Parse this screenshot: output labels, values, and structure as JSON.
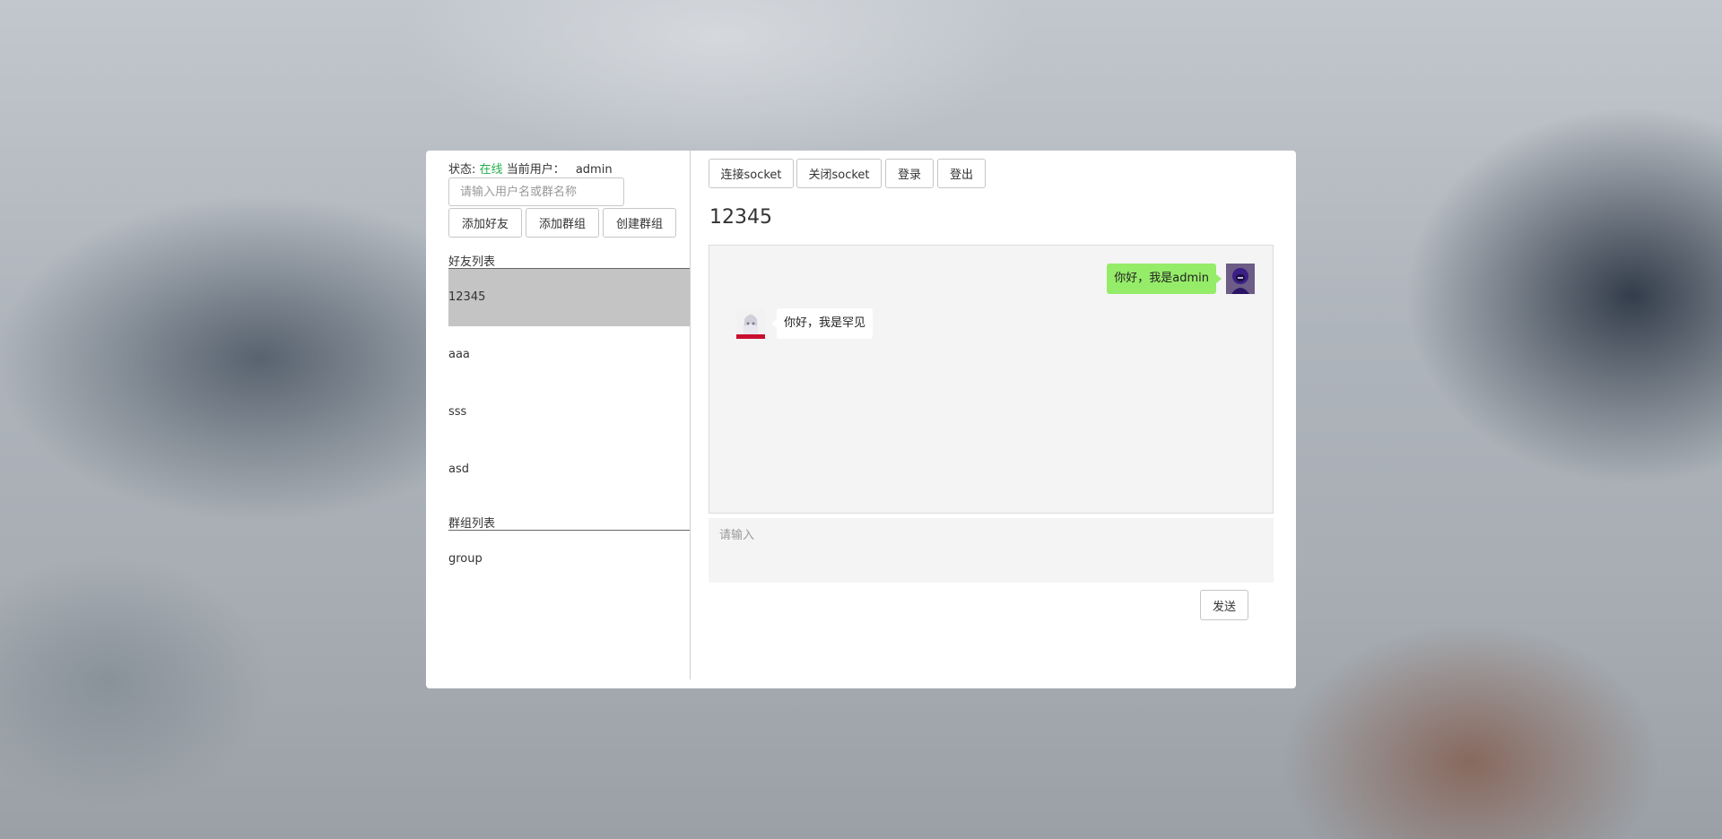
{
  "sidebar": {
    "status_label": "状态:",
    "status_value": "在线",
    "current_user_label": "当前用户：",
    "current_user": "admin",
    "search_placeholder": "请输入用户名或群名称",
    "add_friend": "添加好友",
    "add_group": "添加群组",
    "create_group": "创建群组",
    "friends_title": "好友列表",
    "friends": [
      "12345",
      "aaa",
      "sss",
      "asd"
    ],
    "groups_title": "群组列表",
    "groups": [
      "group"
    ]
  },
  "toolbar": {
    "connect": "连接socket",
    "close": "关闭socket",
    "login": "登录",
    "logout": "登出"
  },
  "chat": {
    "title": "12345",
    "messages": [
      {
        "from": "self",
        "text": "你好，我是admin"
      },
      {
        "from": "other",
        "text": "你好，我是罕见"
      }
    ],
    "input_placeholder": "请输入",
    "send": "发送"
  },
  "colors": {
    "online": "#22b14c",
    "my_bubble": "#95ec69",
    "active_item": "#c4c4c4"
  }
}
